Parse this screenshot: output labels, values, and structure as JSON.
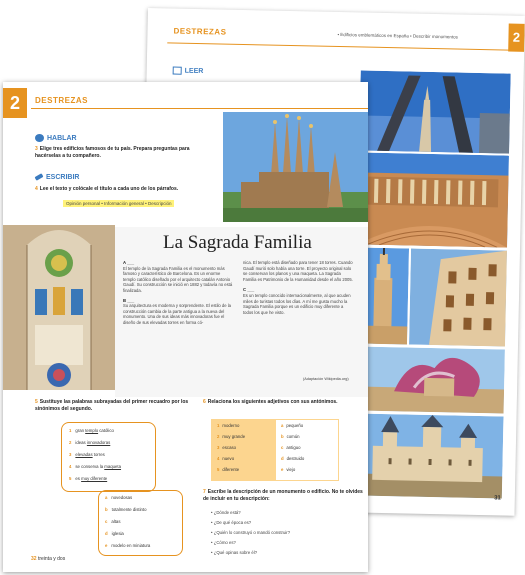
{
  "back": {
    "header": "DESTREZAS",
    "header_right": "• Edificios emblemáticos en España • Describir monumentos",
    "unit": "2",
    "leer_label": "LEER",
    "page_number": "31"
  },
  "front": {
    "unit": "2",
    "header": "DESTREZAS",
    "hablar": {
      "title": "HABLAR",
      "task_num": "3",
      "task": "Elige tres edificios famosos de tu país. Prepara preguntas para hacérselas a tu compañero."
    },
    "escribir": {
      "title": "ESCRIBIR",
      "task_num": "4",
      "task": "Lee el texto y colócale el título a cada uno de los párrafos.",
      "options": "Opinión personal • Información general • Descripción"
    },
    "article": {
      "title": "La Sagrada Familia",
      "para_a_label": "A ___",
      "para_a": "El templo de la Sagrada Familia es el monumento más famoso y característico de Barcelona. Es un enorme templo católico diseñado por el arquitecto catalán Antonio Gaudí. Su construcción se inició en 1882 y todavía no está finalizada.",
      "para_b_label": "B ___",
      "para_b": "Su arquitectura es moderna y sorprendente. El estilo de la construcción cambia de la parte antigua a la nueva del monumento. Una de sus ideas más innovadoras fue el diseño de sus elevadas torres en forma có-",
      "para_b2": "nica. El templo está diseñado para tener 18 torres. Cuando Gaudí murió solo había una torre. El proyecto original solo se conservan los planos y una maqueta. La Sagrada Familia es Patrimonio de la Humanidad desde el año 2005.",
      "para_c_label": "C ___",
      "para_c": "Es un templo conocido internacionalmente, al que acuden miles de turistas todos los días. A mí me gusta mucho la Sagrada Familia porque es un edificio muy diferente a todos los que he visto.",
      "source": "(Adaptación Wikipedia.org)"
    },
    "ex5": {
      "num": "5",
      "task": "Sustituye las palabras subrayadas del primer recuadro por los sinónimos del segundo.",
      "list1": [
        {
          "n": "1",
          "pre": "gran ",
          "u": "templo",
          "post": " católico"
        },
        {
          "n": "2",
          "pre": "ideas ",
          "u": "innovadoras",
          "post": ""
        },
        {
          "n": "3",
          "pre": "",
          "u": "elevadas",
          "post": " torres"
        },
        {
          "n": "4",
          "pre": "se conserva la ",
          "u": "maqueta",
          "post": ""
        },
        {
          "n": "5",
          "pre": "es ",
          "u": "muy diferente",
          "post": ""
        }
      ],
      "list2": [
        {
          "n": "a",
          "t": "novedosas"
        },
        {
          "n": "b",
          "t": "totalmente distinto"
        },
        {
          "n": "c",
          "t": "altas"
        },
        {
          "n": "d",
          "t": "iglesia"
        },
        {
          "n": "e",
          "t": "modelo en miniatura"
        }
      ]
    },
    "ex6": {
      "num": "6",
      "task": "Relaciona los siguientes adjetivos con sus antónimos.",
      "left": [
        {
          "n": "1",
          "t": "moderno"
        },
        {
          "n": "2",
          "t": "muy grande"
        },
        {
          "n": "3",
          "t": "escaso"
        },
        {
          "n": "4",
          "t": "nuevo"
        },
        {
          "n": "5",
          "t": "diferente"
        }
      ],
      "right": [
        {
          "n": "a",
          "t": "pequeño"
        },
        {
          "n": "b",
          "t": "común"
        },
        {
          "n": "c",
          "t": "antiguo"
        },
        {
          "n": "d",
          "t": "destruido"
        },
        {
          "n": "e",
          "t": "viejo"
        }
      ]
    },
    "ex7": {
      "num": "7",
      "task": "Escribe la descripción de un monumento o edificio. No te olvides de incluir en tu descripción:",
      "questions": [
        "• ¿Dónde está?",
        "• ¿De qué época es?",
        "• ¿Quién lo construyó o mandó construir?",
        "• ¿Cómo es?",
        "• ¿Qué opinas sobre él?"
      ]
    },
    "page_number": "32",
    "page_label": "treinta y dos"
  },
  "colors": {
    "accent": "#e69320",
    "blue": "#3b7bbf",
    "yellow": "#fff27a"
  }
}
